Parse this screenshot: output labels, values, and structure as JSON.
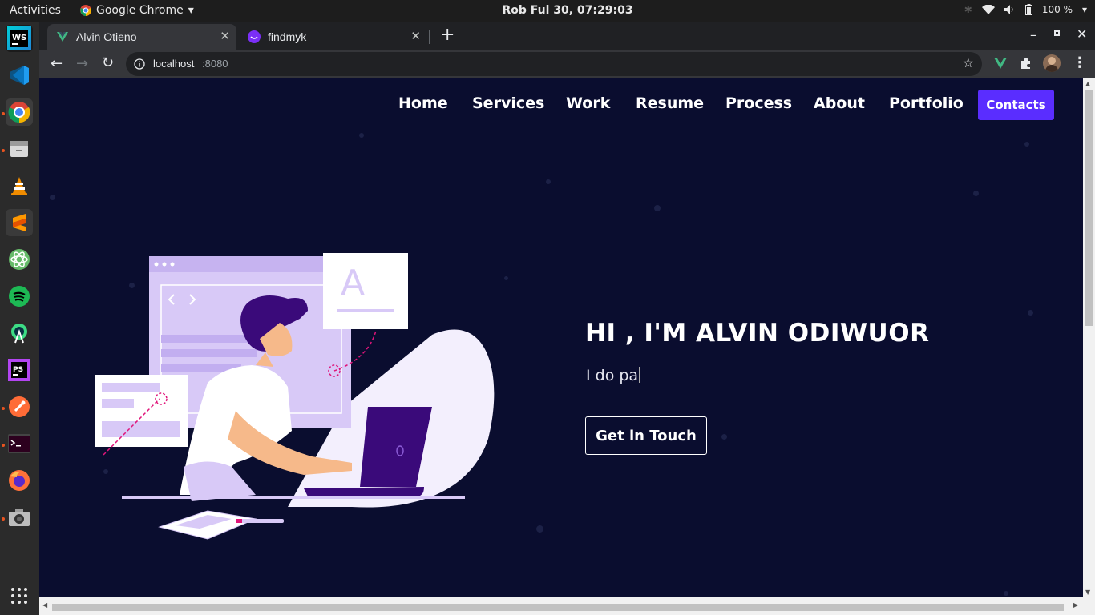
{
  "system": {
    "activities": "Activities",
    "app_name": "Google Chrome",
    "clock": "Rob Ful 30, 07:29:03",
    "battery": "100 %"
  },
  "dock": {
    "icons": [
      "webstorm-icon",
      "vscode-icon",
      "chrome-icon",
      "files-icon",
      "vlc-icon",
      "sublime-icon",
      "atom-icon",
      "spotify-icon",
      "android-studio-icon",
      "phpstorm-icon",
      "postman-icon",
      "terminal-icon",
      "firefox-icon",
      "screenshot-icon",
      "app-grid-icon"
    ]
  },
  "browser": {
    "tabs": [
      {
        "title": "Alvin Otieno",
        "icon": "vue-icon",
        "active": true
      },
      {
        "title": "findmyk",
        "icon": "findmyk-icon",
        "active": false
      }
    ],
    "url_host": "localhost",
    "url_port": ":8080"
  },
  "nav": {
    "items": [
      "Home",
      "Services",
      "Work",
      "Resume",
      "Process",
      "About",
      "Portfolio"
    ],
    "contacts": "Contacts"
  },
  "hero": {
    "title": "HI , I'M ALVIN ODIWUOR",
    "typed": "I do pa",
    "cta": "Get in Touch"
  },
  "colors": {
    "page_bg": "#0a0d2f",
    "accent": "#5a2dff",
    "illustration_purple": "#d8c9f7",
    "illustration_dark": "#3a0a7a"
  }
}
